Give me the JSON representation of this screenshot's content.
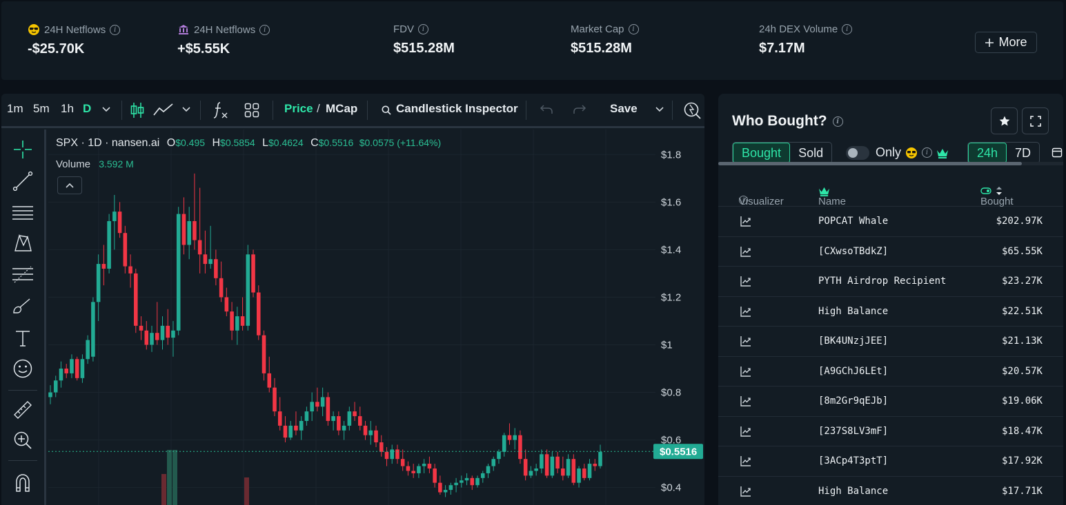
{
  "stats": [
    {
      "label": "24H Netflows",
      "icon": "sunglasses-smart-money-icon",
      "value": "-$25.70K"
    },
    {
      "label": "24H Netflows",
      "icon": "bank-exchange-icon",
      "value": "+$5.55K"
    },
    {
      "label": "FDV",
      "value": "$515.28M"
    },
    {
      "label": "Market Cap",
      "value": "$515.28M"
    },
    {
      "label": "24h DEX Volume",
      "value": "$7.17M"
    }
  ],
  "more_button": "More",
  "toolbar": {
    "intervals": [
      "1m",
      "5m",
      "1h",
      "D"
    ],
    "active_interval": "D",
    "price_label": "Price",
    "slash": "/",
    "mcap_label": "MCap",
    "inspector_label": "Candlestick Inspector",
    "save_label": "Save"
  },
  "legend": {
    "symbol": "SPX · 1D · nansen.ai",
    "o_key": "O",
    "o_val": "$0.495",
    "h_key": "H",
    "h_val": "$0.5854",
    "l_key": "L",
    "l_val": "$0.4624",
    "c_key": "C",
    "c_val": "$0.5516",
    "change": "$0.0575 (+11.64%)",
    "volume_label": "Volume",
    "volume_val": "3.592 M",
    "last_price_tag": "$0.5516"
  },
  "colors": {
    "up": "#22ab94",
    "down": "#f23645",
    "accent": "#2ee6a8",
    "panel": "#131c24",
    "bg": "#0b1118"
  },
  "chart_data": {
    "type": "candlestick",
    "y_ticks": [
      "$1.8",
      "$1.6",
      "$1.4",
      "$1.2",
      "$1",
      "$0.8",
      "$0.6",
      "$0.4"
    ],
    "ylim": [
      0.37,
      1.85
    ],
    "last_price": 0.5516,
    "candles": [
      [
        0.78,
        0.83,
        0.75,
        0.8
      ],
      [
        0.8,
        0.87,
        0.78,
        0.85
      ],
      [
        0.85,
        0.93,
        0.82,
        0.9
      ],
      [
        0.9,
        0.92,
        0.86,
        0.88
      ],
      [
        0.88,
        0.96,
        0.86,
        0.94
      ],
      [
        0.94,
        0.95,
        0.85,
        0.86
      ],
      [
        0.86,
        0.96,
        0.84,
        0.94
      ],
      [
        0.94,
        1.04,
        0.92,
        1.02
      ],
      [
        0.95,
        1.2,
        0.93,
        1.18
      ],
      [
        1.18,
        1.38,
        1.1,
        1.34
      ],
      [
        1.34,
        1.42,
        1.25,
        1.32
      ],
      [
        1.32,
        1.55,
        1.3,
        1.52
      ],
      [
        1.52,
        1.63,
        1.4,
        1.56
      ],
      [
        1.56,
        1.6,
        1.45,
        1.47
      ],
      [
        1.47,
        1.5,
        1.3,
        1.33
      ],
      [
        1.33,
        1.38,
        1.24,
        1.3
      ],
      [
        1.3,
        1.32,
        1.05,
        1.08
      ],
      [
        1.08,
        1.12,
        1.02,
        1.06
      ],
      [
        1.06,
        1.1,
        0.98,
        1.0
      ],
      [
        1.0,
        1.08,
        0.97,
        1.05
      ],
      [
        1.05,
        1.18,
        1.0,
        1.02
      ],
      [
        1.02,
        1.12,
        0.98,
        1.08
      ],
      [
        1.08,
        1.15,
        1.0,
        1.03
      ],
      [
        1.03,
        1.1,
        0.95,
        1.06
      ],
      [
        1.06,
        1.58,
        1.04,
        1.55
      ],
      [
        1.55,
        1.62,
        1.38,
        1.42
      ],
      [
        1.42,
        1.58,
        1.36,
        1.52
      ],
      [
        1.52,
        1.72,
        1.4,
        1.44
      ],
      [
        1.44,
        1.66,
        1.3,
        1.38
      ],
      [
        1.38,
        1.48,
        1.3,
        1.34
      ],
      [
        1.34,
        1.5,
        1.32,
        1.36
      ],
      [
        1.36,
        1.4,
        1.25,
        1.28
      ],
      [
        1.28,
        1.35,
        1.18,
        1.2
      ],
      [
        1.2,
        1.24,
        1.12,
        1.14
      ],
      [
        1.14,
        1.18,
        1.02,
        1.06
      ],
      [
        1.06,
        1.16,
        1.0,
        1.12
      ],
      [
        1.12,
        1.2,
        1.06,
        1.08
      ],
      [
        1.08,
        1.42,
        1.06,
        1.38
      ],
      [
        1.38,
        1.4,
        1.2,
        1.22
      ],
      [
        1.22,
        1.25,
        1.02,
        1.04
      ],
      [
        1.04,
        1.06,
        0.85,
        0.88
      ],
      [
        0.88,
        0.95,
        0.8,
        0.82
      ],
      [
        0.82,
        0.86,
        0.7,
        0.72
      ],
      [
        0.72,
        0.78,
        0.64,
        0.66
      ],
      [
        0.66,
        0.7,
        0.59,
        0.61
      ],
      [
        0.61,
        0.68,
        0.6,
        0.66
      ],
      [
        0.66,
        0.72,
        0.62,
        0.64
      ],
      [
        0.64,
        0.7,
        0.6,
        0.68
      ],
      [
        0.68,
        0.74,
        0.66,
        0.72
      ],
      [
        0.72,
        0.8,
        0.68,
        0.76
      ],
      [
        0.76,
        0.82,
        0.72,
        0.74
      ],
      [
        0.74,
        0.82,
        0.7,
        0.78
      ],
      [
        0.78,
        0.8,
        0.66,
        0.68
      ],
      [
        0.68,
        0.72,
        0.64,
        0.7
      ],
      [
        0.7,
        0.72,
        0.62,
        0.64
      ],
      [
        0.64,
        0.68,
        0.6,
        0.66
      ],
      [
        0.66,
        0.74,
        0.64,
        0.72
      ],
      [
        0.72,
        0.76,
        0.68,
        0.7
      ],
      [
        0.7,
        0.74,
        0.64,
        0.66
      ],
      [
        0.66,
        0.68,
        0.6,
        0.62
      ],
      [
        0.62,
        0.68,
        0.58,
        0.64
      ],
      [
        0.64,
        0.66,
        0.57,
        0.59
      ],
      [
        0.59,
        0.62,
        0.53,
        0.55
      ],
      [
        0.55,
        0.57,
        0.49,
        0.52
      ],
      [
        0.52,
        0.58,
        0.5,
        0.56
      ],
      [
        0.56,
        0.58,
        0.5,
        0.52
      ],
      [
        0.52,
        0.56,
        0.47,
        0.49
      ],
      [
        0.49,
        0.51,
        0.45,
        0.47
      ],
      [
        0.47,
        0.5,
        0.44,
        0.46
      ],
      [
        0.46,
        0.5,
        0.44,
        0.49
      ],
      [
        0.49,
        0.52,
        0.46,
        0.5
      ],
      [
        0.5,
        0.53,
        0.46,
        0.48
      ],
      [
        0.48,
        0.5,
        0.4,
        0.42
      ],
      [
        0.42,
        0.45,
        0.37,
        0.38
      ],
      [
        0.38,
        0.41,
        0.36,
        0.39
      ],
      [
        0.39,
        0.42,
        0.37,
        0.41
      ],
      [
        0.41,
        0.44,
        0.38,
        0.42
      ],
      [
        0.42,
        0.45,
        0.4,
        0.43
      ],
      [
        0.43,
        0.46,
        0.41,
        0.44
      ],
      [
        0.44,
        0.45,
        0.39,
        0.41
      ],
      [
        0.41,
        0.45,
        0.4,
        0.44
      ],
      [
        0.44,
        0.47,
        0.42,
        0.46
      ],
      [
        0.46,
        0.5,
        0.44,
        0.49
      ],
      [
        0.49,
        0.53,
        0.47,
        0.52
      ],
      [
        0.52,
        0.56,
        0.5,
        0.55
      ],
      [
        0.55,
        0.63,
        0.53,
        0.62
      ],
      [
        0.62,
        0.67,
        0.58,
        0.6
      ],
      [
        0.6,
        0.65,
        0.56,
        0.62
      ],
      [
        0.62,
        0.64,
        0.5,
        0.52
      ],
      [
        0.52,
        0.56,
        0.43,
        0.45
      ],
      [
        0.45,
        0.49,
        0.44,
        0.47
      ],
      [
        0.47,
        0.5,
        0.45,
        0.48
      ],
      [
        0.48,
        0.56,
        0.46,
        0.54
      ],
      [
        0.54,
        0.56,
        0.44,
        0.45
      ],
      [
        0.45,
        0.55,
        0.44,
        0.53
      ],
      [
        0.53,
        0.55,
        0.46,
        0.48
      ],
      [
        0.48,
        0.53,
        0.43,
        0.45
      ],
      [
        0.45,
        0.54,
        0.44,
        0.52
      ],
      [
        0.52,
        0.54,
        0.41,
        0.42
      ],
      [
        0.42,
        0.49,
        0.4,
        0.48
      ],
      [
        0.48,
        0.5,
        0.43,
        0.44
      ],
      [
        0.44,
        0.52,
        0.43,
        0.5
      ],
      [
        0.5,
        0.52,
        0.47,
        0.49
      ],
      [
        0.49,
        0.58,
        0.48,
        0.55
      ]
    ]
  },
  "who_bought": {
    "title": "Who Bought?",
    "tabs": [
      "Bought",
      "Sold"
    ],
    "active_tab": "Bought",
    "only_label": "Only",
    "periods": [
      "24h",
      "7D"
    ],
    "active_period": "24h",
    "columns": {
      "visualizer": "Visualizer",
      "name": "Name",
      "bought": "Bought"
    },
    "rows": [
      {
        "name": "POPCAT Whale",
        "amount": "$202.97K"
      },
      {
        "name": "[CXwsoTBdkZ]",
        "amount": "$65.55K"
      },
      {
        "name": "PYTH Airdrop Recipient",
        "amount": "$23.27K"
      },
      {
        "name": "High Balance",
        "amount": "$22.51K"
      },
      {
        "name": "[BK4UNzjJEE]",
        "amount": "$21.13K"
      },
      {
        "name": "[A9GChJ6LEt]",
        "amount": "$20.57K"
      },
      {
        "name": "[8m2Gr9qEJb]",
        "amount": "$19.06K"
      },
      {
        "name": "[237S8LV3mF]",
        "amount": "$18.47K"
      },
      {
        "name": "[3ACp4T3ptT]",
        "amount": "$17.92K"
      },
      {
        "name": "High Balance",
        "amount": "$17.71K"
      }
    ]
  }
}
